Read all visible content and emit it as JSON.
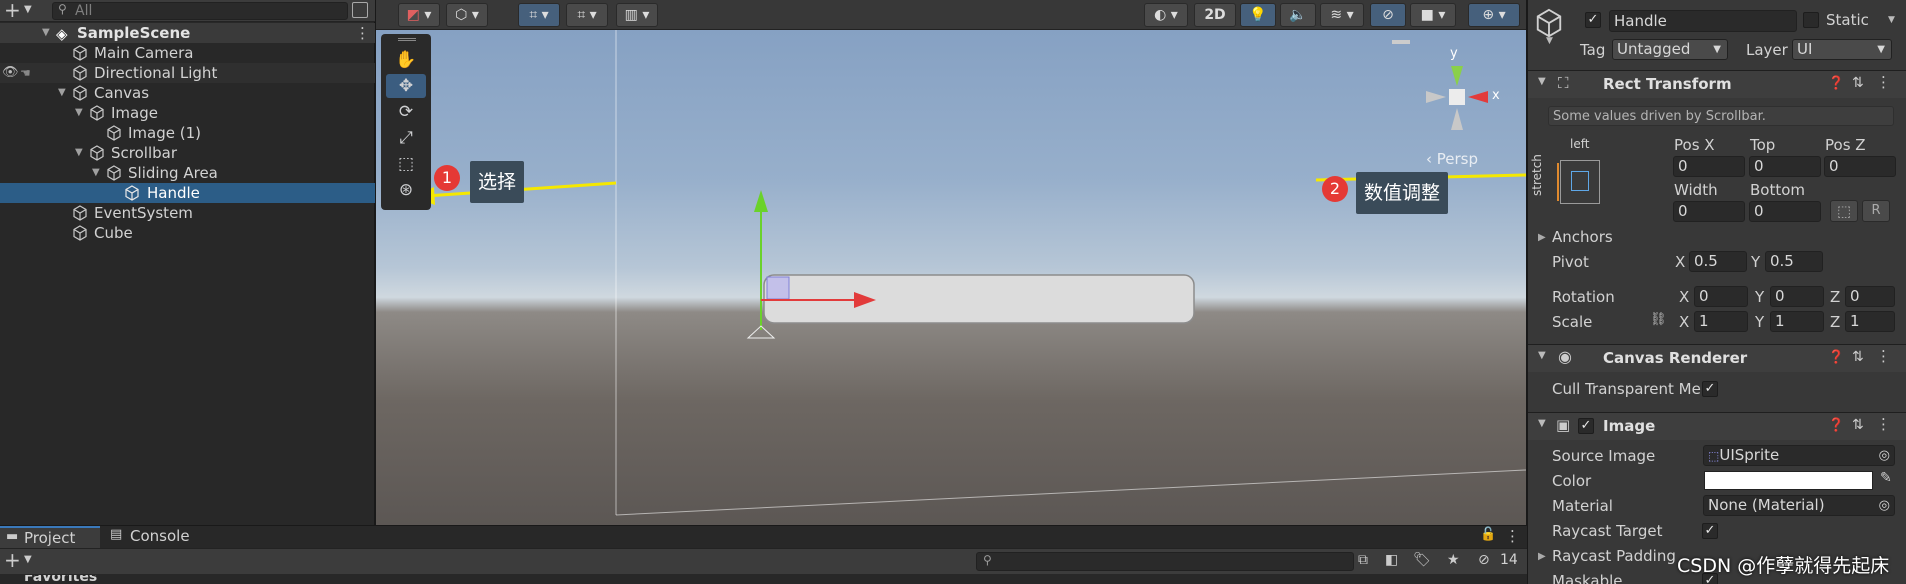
{
  "hierarchy": {
    "search_placeholder": "All",
    "items": [
      {
        "label": "SampleScene"
      },
      {
        "label": "Main Camera"
      },
      {
        "label": "Directional Light"
      },
      {
        "label": "Canvas"
      },
      {
        "label": "Image"
      },
      {
        "label": "Image (1)"
      },
      {
        "label": "Scrollbar"
      },
      {
        "label": "Sliding Area"
      },
      {
        "label": "Handle"
      },
      {
        "label": "EventSystem"
      },
      {
        "label": "Cube"
      }
    ]
  },
  "scene": {
    "btn_2d": "2D",
    "gizmo_y": "y",
    "gizmo_x": "x",
    "persp": "‹ Persp",
    "annotation1": {
      "num": "1",
      "text": "选择"
    },
    "annotation2": {
      "num": "2",
      "text": "数值调整"
    }
  },
  "inspector": {
    "name": "Handle",
    "static_label": "Static",
    "tag_label": "Tag",
    "tag_value": "Untagged",
    "layer_label": "Layer",
    "layer_value": "UI",
    "rect_title": "Rect Transform",
    "driven_note": "Some values driven by Scrollbar.",
    "anchor_top": "left",
    "anchor_side": "stretch",
    "pos_x_label": "Pos X",
    "pos_x": "0",
    "top_label": "Top",
    "top": "0",
    "pos_z_label": "Pos Z",
    "pos_z": "0",
    "width_label": "Width",
    "width": "0",
    "bottom_label": "Bottom",
    "bottom": "0",
    "r_btn": "R",
    "anchors_label": "Anchors",
    "pivot_label": "Pivot",
    "pivot_x": "0.5",
    "pivot_y": "0.5",
    "rotation_label": "Rotation",
    "rot_x": "0",
    "rot_y": "0",
    "rot_z": "0",
    "scale_label": "Scale",
    "scale_x": "1",
    "scale_y": "1",
    "scale_z": "1",
    "x": "X",
    "y": "Y",
    "z": "Z",
    "canvas_renderer_title": "Canvas Renderer",
    "cull_label": "Cull Transparent Me:",
    "image_title": "Image",
    "source_image_label": "Source Image",
    "source_image": "UISprite",
    "color_label": "Color",
    "material_label": "Material",
    "material": "None (Material)",
    "raycast_target_label": "Raycast Target",
    "raycast_padding_label": "Raycast Padding",
    "maskable_label": "Maskable",
    "check": "✓"
  },
  "bottom": {
    "project_tab": "Project",
    "console_tab": "Console",
    "favorites": "Favorites",
    "hidden_count": "14"
  },
  "watermark": "CSDN @作孽就得先起床",
  "colors": {
    "selection": "#2c5d87",
    "accent_on": "#46607c",
    "annotation_red": "#e53935",
    "arrow_yellow": "#f5e800"
  }
}
